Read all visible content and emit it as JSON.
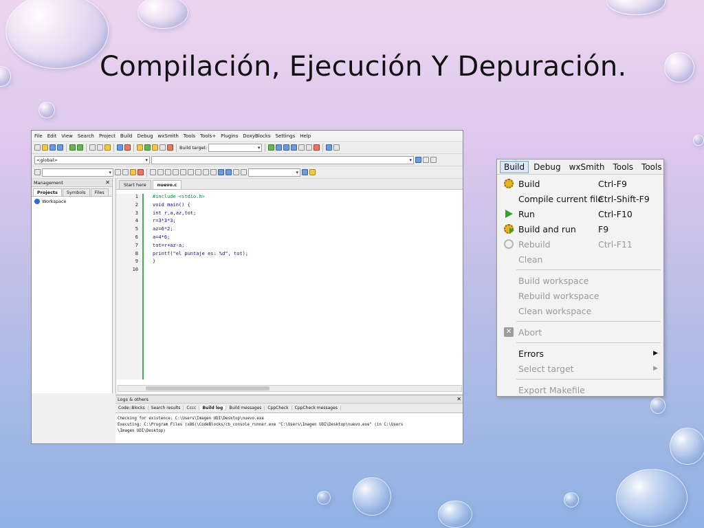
{
  "slide": {
    "title": "Compilación, Ejecución Y Depuración."
  },
  "ide": {
    "menu": [
      "File",
      "Edit",
      "View",
      "Search",
      "Project",
      "Build",
      "Debug",
      "wxSmith",
      "Tools",
      "Tools+",
      "Plugins",
      "DoxyBlocks",
      "Settings",
      "Help"
    ],
    "build_target_label": "Build target:",
    "scope_combo": "<global>",
    "management": {
      "title": "Management",
      "tabs": [
        "Projects",
        "Symbols",
        "Files"
      ],
      "workspace": "Workspace"
    },
    "editor_tabs": [
      "Start here",
      "nuevo.c"
    ],
    "code_lines": [
      "#include <stdio.h>",
      "void main() {",
      "int r,a,az,tot;",
      "r=3*3*3;",
      "az=6*2;",
      "a=4*6;",
      "tot=r+az-a;",
      "printf(\"el puntaje es: %d\", tot);",
      "}",
      ""
    ],
    "line_numbers": [
      "1",
      "2",
      "3",
      "4",
      "5",
      "6",
      "7",
      "8",
      "9",
      "10"
    ],
    "logs": {
      "title": "Logs & others",
      "tabs": [
        "Code::Blocks",
        "Search results",
        "Cccc",
        "Build log",
        "Build messages",
        "CppCheck",
        "CppCheck messages"
      ],
      "lines": [
        "Checking for existence: C:\\Users\\Imagen UDI\\Desktop\\nuevo.exe",
        "Executing: C:\\Program Files (x86)\\CodeBlocks/cb_console_runner.exe \"C:\\Users\\Imagen UDI\\Desktop\\nuevo.exe\" (in C:\\Users",
        "\\Imagen UDI\\Desktop)"
      ]
    }
  },
  "build_menu": {
    "menubar": [
      "Build",
      "Debug",
      "wxSmith",
      "Tools",
      "Tools"
    ],
    "items": [
      {
        "label": "Build",
        "shortcut": "Ctrl-F9",
        "icon": "gear-icon",
        "enabled": true
      },
      {
        "label": "Compile current file",
        "shortcut": "Ctrl-Shift-F9",
        "icon": "",
        "enabled": true
      },
      {
        "label": "Run",
        "shortcut": "Ctrl-F10",
        "icon": "run-icon",
        "enabled": true
      },
      {
        "label": "Build and run",
        "shortcut": "F9",
        "icon": "build-run-icon",
        "enabled": true
      },
      {
        "label": "Rebuild",
        "shortcut": "Ctrl-F11",
        "icon": "rebuild-icon",
        "enabled": false
      },
      {
        "label": "Clean",
        "shortcut": "",
        "icon": "",
        "enabled": false
      },
      {
        "label": "Build workspace",
        "shortcut": "",
        "icon": "",
        "enabled": false
      },
      {
        "label": "Rebuild workspace",
        "shortcut": "",
        "icon": "",
        "enabled": false
      },
      {
        "label": "Clean workspace",
        "shortcut": "",
        "icon": "",
        "enabled": false
      },
      {
        "label": "Abort",
        "shortcut": "",
        "icon": "abort-icon",
        "enabled": false
      },
      {
        "label": "Errors",
        "shortcut": "",
        "icon": "",
        "enabled": true
      },
      {
        "label": "Select target",
        "shortcut": "",
        "icon": "",
        "enabled": false
      },
      {
        "label": "Export Makefile",
        "shortcut": "",
        "icon": "",
        "enabled": false
      }
    ]
  }
}
